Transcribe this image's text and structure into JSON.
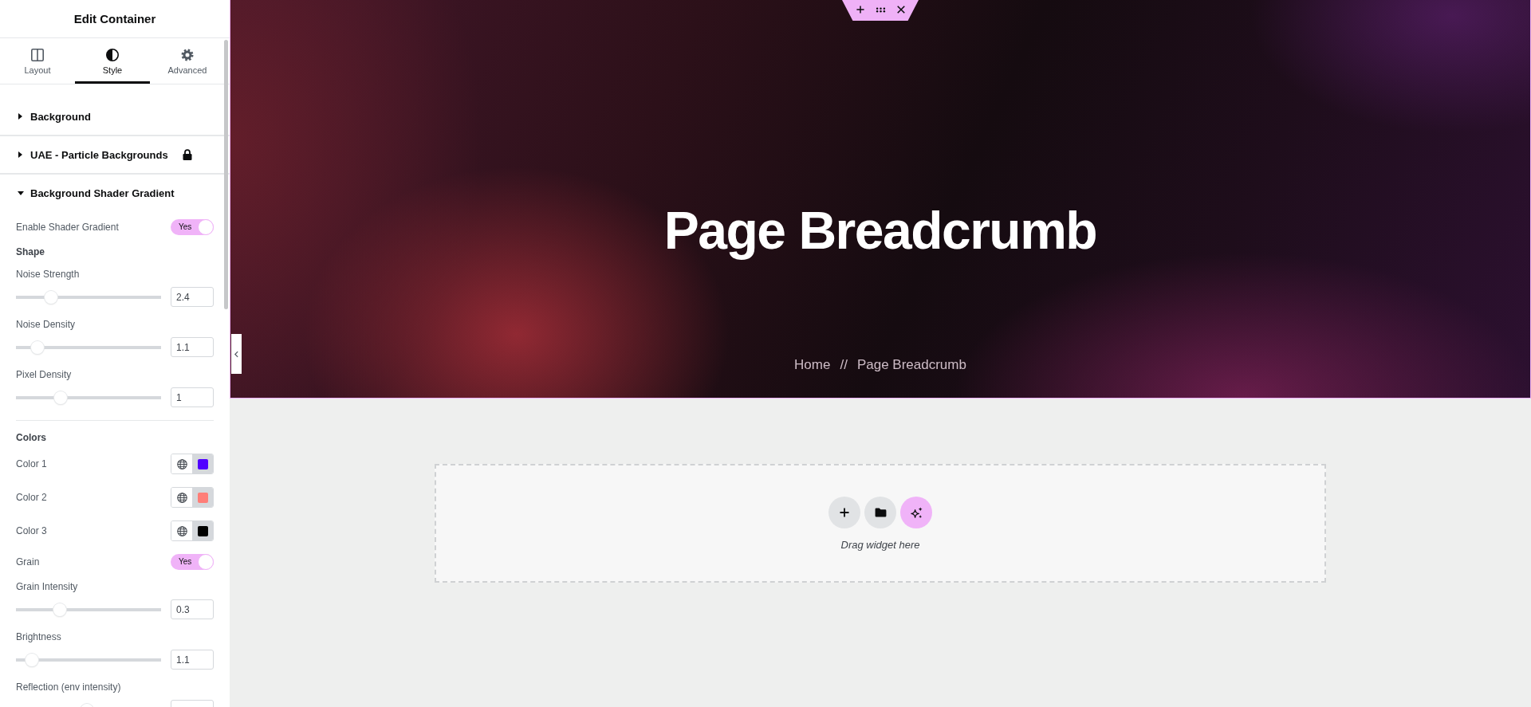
{
  "panel": {
    "title": "Edit Container",
    "tabs": [
      {
        "label": "Layout",
        "selected": false
      },
      {
        "label": "Style",
        "selected": true
      },
      {
        "label": "Advanced",
        "selected": false
      }
    ],
    "sections": [
      {
        "title": "Background",
        "expanded": false,
        "locked": false
      },
      {
        "title": "UAE - Particle Backgrounds",
        "expanded": false,
        "locked": true
      },
      {
        "title": "Background Shader Gradient",
        "expanded": true,
        "locked": false,
        "controls": [
          {
            "kind": "toggle",
            "label": "Enable Shader Gradient",
            "on": true,
            "text": "Yes"
          },
          {
            "kind": "heading",
            "label": "Shape"
          },
          {
            "kind": "slider",
            "label": "Noise Strength",
            "level": 0.24,
            "value": "2.4"
          },
          {
            "kind": "slider",
            "label": "Noise Density",
            "level": 0.15,
            "value": "1.1"
          },
          {
            "kind": "slider",
            "label": "Pixel Density",
            "level": 0.31,
            "value": "1"
          },
          {
            "kind": "divider"
          },
          {
            "kind": "heading",
            "label": "Colors"
          },
          {
            "kind": "color",
            "label": "Color 1",
            "color": "#5000ff"
          },
          {
            "kind": "color",
            "label": "Color 2",
            "color": "#ff7e78"
          },
          {
            "kind": "color",
            "label": "Color 3",
            "color": "#000000"
          },
          {
            "kind": "toggle",
            "label": "Grain",
            "on": true,
            "text": "Yes"
          },
          {
            "kind": "slider",
            "label": "Grain Intensity",
            "level": 0.3,
            "value": "0.3"
          },
          {
            "kind": "slider",
            "label": "Brightness",
            "level": 0.11,
            "value": "1.1"
          },
          {
            "kind": "slider",
            "label": "Reflection (env intensity)",
            "level": 0.49
          }
        ]
      }
    ]
  },
  "hero": {
    "title": "Page Breadcrumb",
    "breadcrumb": [
      {
        "label": "Home"
      },
      {
        "label": "Page Breadcrumb"
      }
    ],
    "separator": "//"
  },
  "drop_zone": {
    "hint": "Drag widget here"
  }
}
